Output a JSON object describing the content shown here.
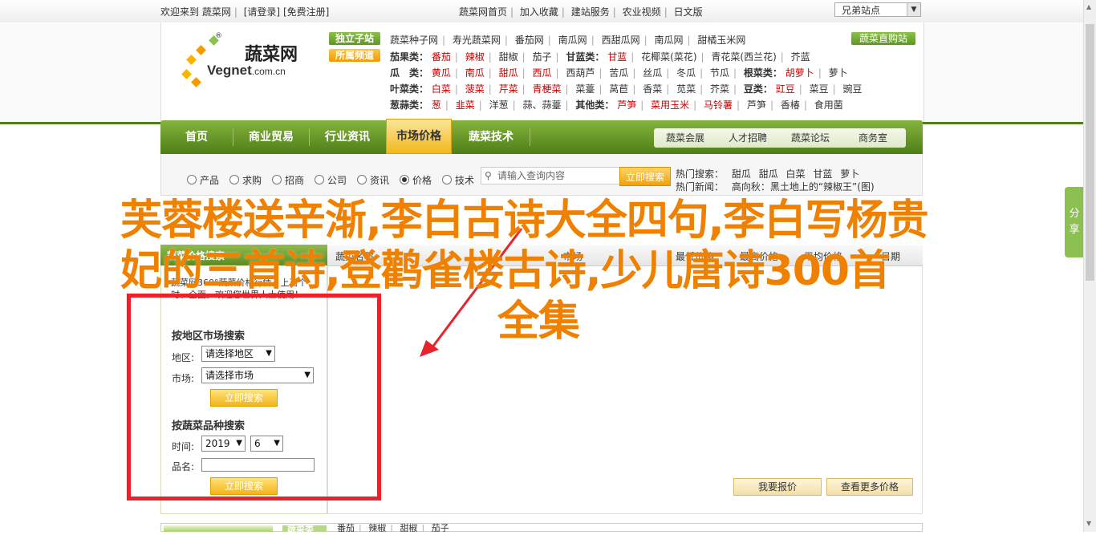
{
  "topbar": {
    "left_links": [
      "欢迎来到",
      "蔬菜网",
      "[请登录]",
      "[免费注册]"
    ],
    "right_links": [
      "蔬菜网首页",
      "加入收藏",
      "建站服务",
      "农业视频",
      "日文版"
    ],
    "lang_select": "兄弟站点"
  },
  "logo": {
    "cn": "蔬菜网",
    "en": "Vegnet",
    "domain": ".com.cn",
    "reg": "®"
  },
  "header": {
    "tag1": "独立子站",
    "tag2": "所属频道",
    "direct": "蔬菜直购站",
    "row0": [
      "蔬菜种子网",
      "寿光蔬菜网",
      "番茄网",
      "南瓜网",
      "西甜瓜网",
      "南瓜网",
      "甜橘玉米网"
    ],
    "rows": [
      {
        "label": "茄果类：",
        "items": [
          "番茄",
          "辣椒",
          "甜椒",
          "茄子"
        ],
        "label2": "甘蓝类：",
        "items2": [
          "甘蓝",
          "花椰菜(菜花)",
          "青花菜(西兰花)",
          "芥蓝"
        ]
      },
      {
        "label": "瓜　类：",
        "items": [
          "黄瓜",
          "南瓜",
          "甜瓜",
          "西瓜",
          "西葫芦",
          "苦瓜",
          "丝瓜",
          "冬瓜",
          "节瓜"
        ],
        "label2": "根菜类：",
        "items2": [
          "胡萝卜",
          "萝卜"
        ]
      },
      {
        "label": "叶菜类：",
        "items": [
          "白菜",
          "菠菜",
          "芹菜",
          "青梗菜",
          "菜薹",
          "莴苣",
          "香菜",
          "苋菜",
          "芥菜"
        ],
        "label2": "豆类：",
        "items2": [
          "豇豆",
          "菜豆",
          "豌豆"
        ]
      },
      {
        "label": "葱蒜类：",
        "items": [
          "葱",
          "韭菜",
          "洋葱",
          "蒜、蒜薹"
        ],
        "label2": "其他类：",
        "items2": [
          "芦笋",
          "菜用玉米",
          "马铃薯",
          "芦笋",
          "香椿",
          "食用菌"
        ]
      }
    ]
  },
  "nav": {
    "items": [
      "首页",
      "商业贸易",
      "行业资讯",
      "市场价格",
      "蔬菜技术"
    ],
    "active_index": 3,
    "sub": [
      "蔬菜会展",
      "人才招聘",
      "蔬菜论坛",
      "商务室"
    ]
  },
  "search": {
    "options": [
      "产品",
      "求购",
      "招商",
      "公司",
      "资讯",
      "价格",
      "技术"
    ],
    "selected": "价格",
    "placeholder": "请输入查询内容",
    "button": "立即搜索",
    "hot_label": "热门搜索：",
    "hot_items": [
      "甜瓜",
      "甜瓜",
      "白菜",
      "甘蓝",
      "萝卜"
    ],
    "news_label": "热门新闻：",
    "news_text": "高向秋：黑土地上的“辣椒王”(图)"
  },
  "left": {
    "head": "蔬菜价格搜索",
    "intro": "蔬菜网360°蔬菜价格行情，上百个时、全面。欢迎您世界人士使用！",
    "region_title": "按地区市场搜索",
    "region_label": "地区:",
    "region_value": "请选择地区",
    "market_label": "市场:",
    "market_value": "请选择市场",
    "search_btn": "立即搜索",
    "veg_title": "按蔬菜品种搜索",
    "time_label": "时间:",
    "year": "2019",
    "month": "6",
    "name_label": "品名:",
    "search_btn2": "立即搜索"
  },
  "table": {
    "headers": [
      "蔬菜名称",
      "市场",
      "最低价格",
      "最高价格",
      "平均价格",
      "日期"
    ],
    "btn_report": "我要报价",
    "btn_more": "查看更多价格"
  },
  "bottom": {
    "tag": "蔬菜类",
    "items": [
      "番茄",
      "辣椒",
      "甜椒",
      "茄子"
    ]
  },
  "share": {
    "label": [
      "分",
      "享"
    ]
  },
  "overlay": {
    "line1": "芙蓉楼送辛渐,李白古诗大全四句,李白写杨贵",
    "line2": "妃的三首诗,登鹳雀楼古诗,少儿唐诗300首",
    "line3": "全集"
  },
  "colors": {
    "brand_green": "#5b8b20",
    "accent_orange": "#ef8000",
    "highlight_red": "#e8232b",
    "price_red": "#cc0000"
  }
}
